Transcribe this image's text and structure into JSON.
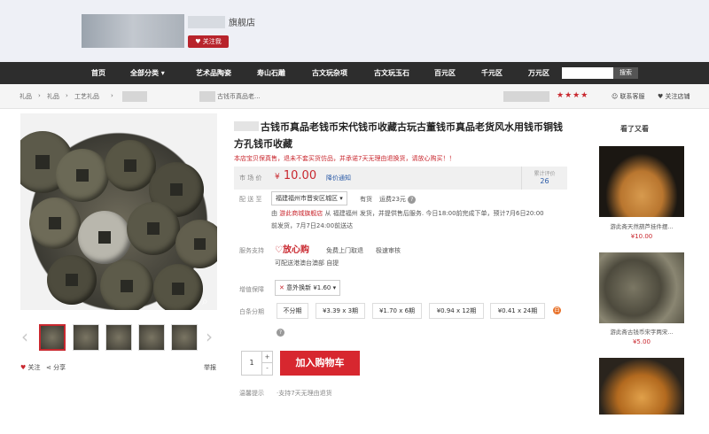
{
  "store": {
    "name": "旗舰店",
    "follow_label": "关注我"
  },
  "nav": {
    "items": [
      "首页",
      "全部分类 ▾",
      "艺术品陶瓷",
      "寿山石雕",
      "古文玩杂项",
      "古文玩玉石",
      "百元区",
      "千元区",
      "万元区"
    ],
    "search_button": "搜索"
  },
  "breadcrumb": {
    "items": [
      "礼品",
      "礼品",
      "工艺礼品"
    ],
    "current": "古钱币真品老..."
  },
  "shop": {
    "stars": "★★★★",
    "service_label": "联系客服",
    "follow_shop_label": "关注店铺"
  },
  "product": {
    "title": "古钱币真品老钱币宋代钱币收藏古玩古董钱币真品老货风水用钱币铜钱 方孔钱币收藏",
    "subtitle": "本店宝贝保真售，退未不套买货仿品，并承诺7天无理由退换货，请放心购买！！",
    "price_label": "市 场 价",
    "price_currency": "¥",
    "price": "10.00",
    "price_notify": "降价通知",
    "review_label": "累计评价",
    "review_count": "26",
    "delivery_label": "配 送 至",
    "delivery_region": "福建福州市晋安区城区",
    "stock": "有货",
    "shipping": "运费23元",
    "shipping_note_prefix": "由",
    "shipping_note_store": "游此商城旗舰店",
    "shipping_note": "从 福建福州 发货，并提供售后服务. 今日18:00前完成下单，预计7月6日20:00",
    "shipping_note2": "前发货，7月7日24:00前送达",
    "service_label": "服务支持",
    "service_logo": "♡放心购",
    "service_items": [
      "免费上门取退",
      "极速审核"
    ],
    "service_extra": "可配送港澳台澳部 自提",
    "warranty_label": "增值保障",
    "warranty_value": "意外换新 ¥1.60 ▾",
    "installment_label": "白条分期",
    "installments": [
      "不分期",
      "¥3.39 x 3期",
      "¥1.70 x 6期",
      "¥0.94 x 12期",
      "¥0.41 x 24期"
    ],
    "quantity": "1",
    "add_to_cart": "加入购物车",
    "tip_label": "温馨提示",
    "tip_text": "·支持7天无理由退货"
  },
  "actions": {
    "follow": "关注",
    "share": "分享",
    "report": "举报"
  },
  "sidebar": {
    "title": "看了又看",
    "items": [
      {
        "caption": "游此斋天然葫芦挂件摆...",
        "price": "¥10.00"
      },
      {
        "caption": "游此斋古钱币宋字两宋...",
        "price": "¥5.00"
      }
    ]
  },
  "colors": {
    "accent": "#c9282f",
    "nav_bg": "#2d2d2d",
    "link": "#2a5aa7"
  }
}
